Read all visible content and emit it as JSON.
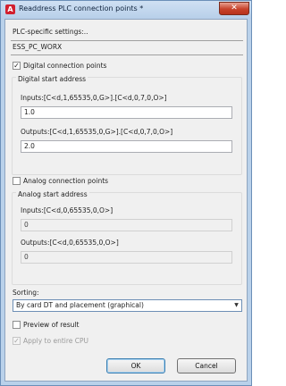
{
  "window": {
    "title": "Readdress PLC connection points *",
    "app_icon_glyph": "A",
    "close_glyph": "✕"
  },
  "plc": {
    "settings_label": "PLC-specific settings:..",
    "settings_value": "ESS_PC_WORX"
  },
  "digital": {
    "checkbox_label": "Digital connection points",
    "checked": true,
    "group_title": "Digital start address",
    "inputs_label": "Inputs:[C<d,1,65535,0,G>].[C<d,0,7,0,O>]",
    "inputs_value": "1.0",
    "outputs_label": "Outputs:[C<d,1,65535,0,G>].[C<d,0,7,0,O>]",
    "outputs_value": "2.0"
  },
  "analog": {
    "checkbox_label": "Analog connection points",
    "checked": false,
    "group_title": "Analog start address",
    "inputs_label": "Inputs:[C<d,0,65535,0,O>]",
    "inputs_value": "0",
    "outputs_label": "Outputs:[C<d,0,65535,0,O>]",
    "outputs_value": "0"
  },
  "sorting": {
    "label": "Sorting:",
    "selected": "By card DT and placement (graphical)"
  },
  "preview": {
    "label": "Preview of result",
    "checked": false
  },
  "apply_cpu": {
    "label": "Apply to entire CPU",
    "checked": true,
    "disabled": true
  },
  "buttons": {
    "ok": "OK",
    "cancel": "Cancel"
  },
  "icons": {
    "check": "✓",
    "dropdown": "▼"
  }
}
